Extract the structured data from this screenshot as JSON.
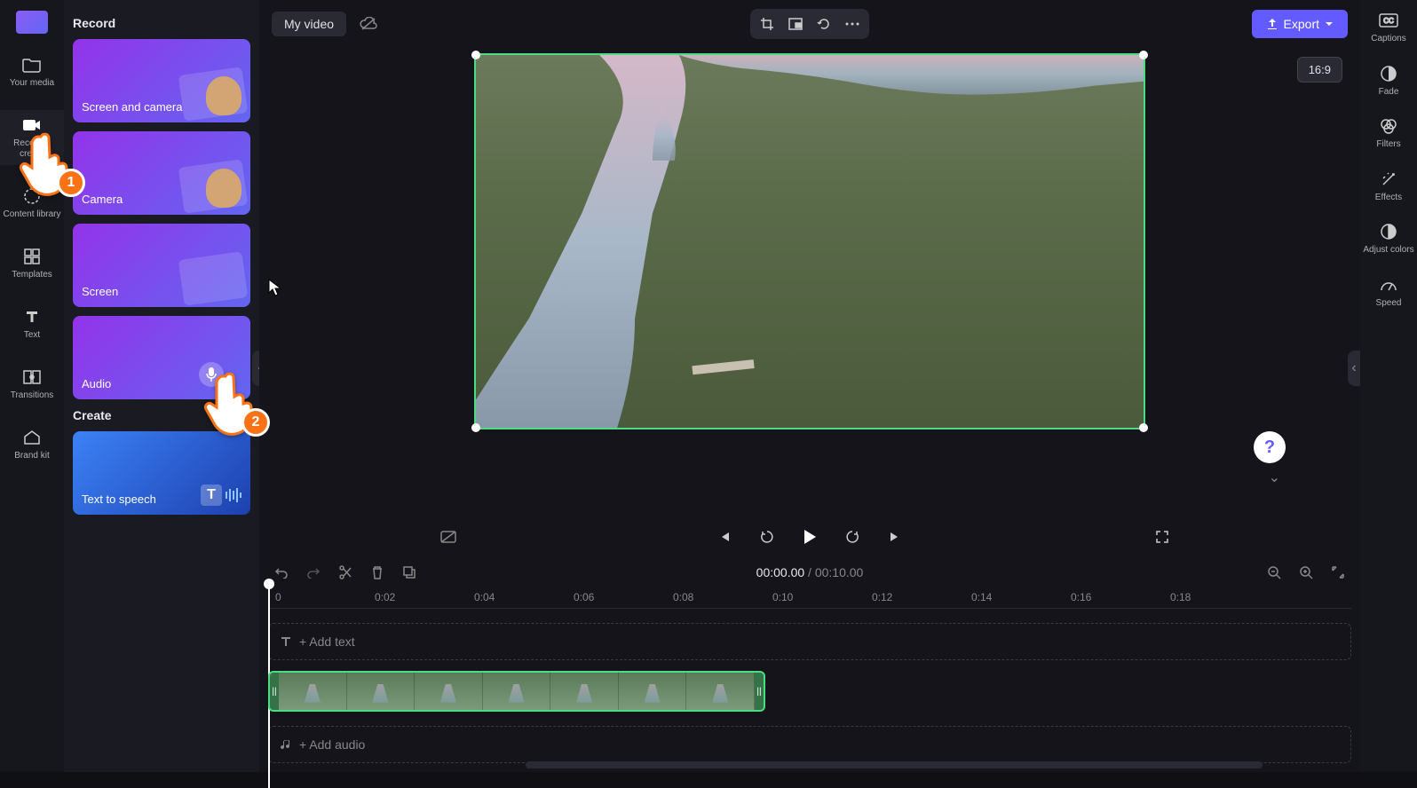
{
  "left_rail": {
    "items": [
      {
        "label": "Your media"
      },
      {
        "label": "Record & create"
      },
      {
        "label": "Content library"
      },
      {
        "label": "Templates"
      },
      {
        "label": "Text"
      },
      {
        "label": "Transitions"
      },
      {
        "label": "Brand kit"
      }
    ]
  },
  "side_panel": {
    "section1_title": "Record",
    "cards": [
      {
        "label": "Screen and camera"
      },
      {
        "label": "Camera"
      },
      {
        "label": "Screen"
      },
      {
        "label": "Audio"
      }
    ],
    "section2_title": "Create",
    "create_cards": [
      {
        "label": "Text to speech"
      }
    ]
  },
  "topbar": {
    "title": "My video",
    "export_label": "Export"
  },
  "aspect": "16:9",
  "playback": {
    "current": "00:00.00",
    "total": "00:10.00"
  },
  "ruler": {
    "ticks": [
      "0",
      "0:02",
      "0:04",
      "0:06",
      "0:08",
      "0:10",
      "0:12",
      "0:14",
      "0:16",
      "0:18"
    ]
  },
  "tracks": {
    "add_text": "+ Add text",
    "add_audio": "+ Add audio"
  },
  "right_rail": {
    "items": [
      {
        "label": "Captions"
      },
      {
        "label": "Fade"
      },
      {
        "label": "Filters"
      },
      {
        "label": "Effects"
      },
      {
        "label": "Adjust colors"
      },
      {
        "label": "Speed"
      }
    ]
  },
  "annotations": {
    "badge1": "1",
    "badge2": "2"
  },
  "help": "?"
}
